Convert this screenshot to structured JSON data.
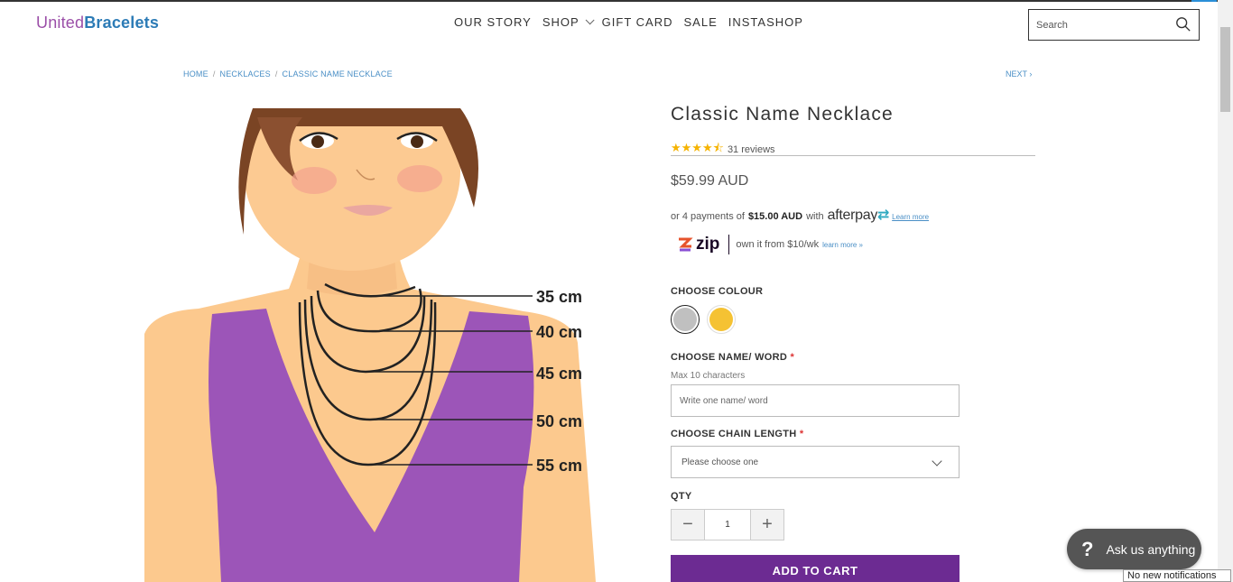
{
  "header": {
    "logo_part1": "United",
    "logo_part2": "Bracelets",
    "nav": [
      "OUR STORY",
      "SHOP",
      "GIFT CARD",
      "SALE",
      "INSTASHOP"
    ],
    "search_placeholder": "Search"
  },
  "breadcrumb": {
    "items": [
      "HOME",
      "NECKLACES",
      "CLASSIC NAME NECKLACE"
    ],
    "next": "NEXT"
  },
  "product_image": {
    "chain_labels": [
      "35 cm",
      "40 cm",
      "45 cm",
      "50 cm",
      "55 cm"
    ]
  },
  "product": {
    "title": "Classic Name Necklace",
    "rating_stars": 4.5,
    "reviews": "31 reviews",
    "price": "$59.99 AUD"
  },
  "afterpay": {
    "prefix": "or 4 payments of",
    "amount": "$15.00 AUD",
    "with": "with",
    "logo": "afterpay",
    "link": "Learn more"
  },
  "zip": {
    "logo": "zip",
    "text": "own it from $10/wk",
    "link": "learn more »"
  },
  "options": {
    "colour_label": "CHOOSE COLOUR",
    "colours": [
      "silver",
      "gold"
    ],
    "colour_hex": [
      "#c0c0c0",
      "#f5c233"
    ],
    "name_label": "CHOOSE NAME/ WORD",
    "name_hint": "Max 10 characters",
    "name_placeholder": "Write one name/ word",
    "chain_label": "CHOOSE CHAIN LENGTH",
    "chain_value": "Please choose one",
    "required_mark": "*",
    "qty_label": "QTY",
    "qty_value": "1",
    "qty_minus": "−",
    "qty_plus": "+",
    "add_to_cart": "ADD TO CART"
  },
  "chat": {
    "icon": "?",
    "label": "Ask us anything"
  },
  "notification": "No new notifications",
  "colors": {
    "brand_purple": "#6c2b92",
    "link_blue": "#4a8fc6",
    "star_gold": "#f5b301"
  }
}
